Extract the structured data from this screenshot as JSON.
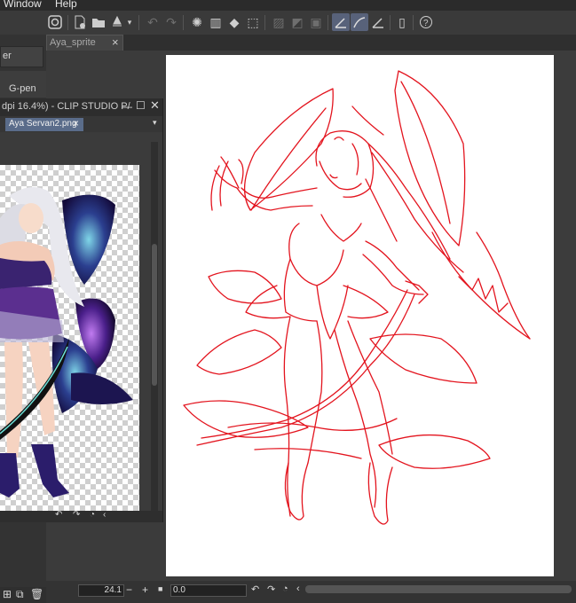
{
  "menu": {
    "window": "Window",
    "help": "Help"
  },
  "document_tab": {
    "label": "Aya_sprite",
    "close": "×"
  },
  "left_panel": {
    "item1": "er",
    "item2": "G-pen"
  },
  "subwindow": {
    "title": "dpi 16.4%)  - CLIP STUDIO P/",
    "tab_label": "Aya Servan2.png",
    "tab_close": "×"
  },
  "status": {
    "zoom": "24.1",
    "rotation": "0.0",
    "minus": "−",
    "plus": "+"
  },
  "colors": {
    "sketch_line": "#e3141e",
    "active_tool": "#58627a",
    "sub_tab": "#5a6c8a"
  }
}
